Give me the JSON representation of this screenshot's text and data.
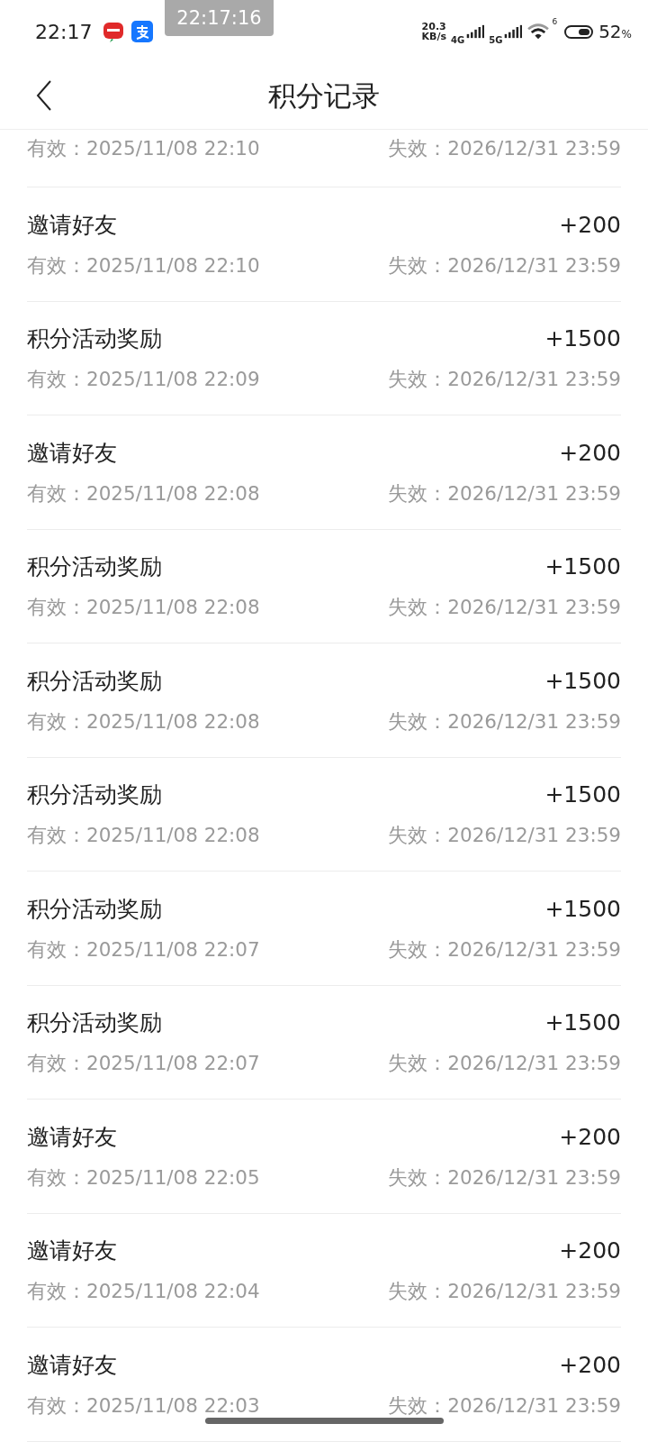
{
  "status_bar": {
    "time": "22:17",
    "floating_clock": "22:17:16",
    "net_speed": "20.3",
    "net_unit": "KB/s",
    "sim1": "4G",
    "sim2": "5G",
    "wifi_label": "6",
    "battery": "52",
    "battery_unit": "%"
  },
  "header": {
    "title": "积分记录"
  },
  "partial_record": {
    "valid_label": "有效：",
    "valid": "2025/11/08 22:10",
    "expire_label": "失效：",
    "expire": "2026/12/31 23:59"
  },
  "records": [
    {
      "title": "邀请好友",
      "points": "+200",
      "valid_label": "有效：",
      "valid": "2025/11/08 22:10",
      "expire_label": "失效：",
      "expire": "2026/12/31 23:59"
    },
    {
      "title": "积分活动奖励",
      "points": "+1500",
      "valid_label": "有效：",
      "valid": "2025/11/08 22:09",
      "expire_label": "失效：",
      "expire": "2026/12/31 23:59"
    },
    {
      "title": "邀请好友",
      "points": "+200",
      "valid_label": "有效：",
      "valid": "2025/11/08 22:08",
      "expire_label": "失效：",
      "expire": "2026/12/31 23:59"
    },
    {
      "title": "积分活动奖励",
      "points": "+1500",
      "valid_label": "有效：",
      "valid": "2025/11/08 22:08",
      "expire_label": "失效：",
      "expire": "2026/12/31 23:59"
    },
    {
      "title": "积分活动奖励",
      "points": "+1500",
      "valid_label": "有效：",
      "valid": "2025/11/08 22:08",
      "expire_label": "失效：",
      "expire": "2026/12/31 23:59"
    },
    {
      "title": "积分活动奖励",
      "points": "+1500",
      "valid_label": "有效：",
      "valid": "2025/11/08 22:08",
      "expire_label": "失效：",
      "expire": "2026/12/31 23:59"
    },
    {
      "title": "积分活动奖励",
      "points": "+1500",
      "valid_label": "有效：",
      "valid": "2025/11/08 22:07",
      "expire_label": "失效：",
      "expire": "2026/12/31 23:59"
    },
    {
      "title": "积分活动奖励",
      "points": "+1500",
      "valid_label": "有效：",
      "valid": "2025/11/08 22:07",
      "expire_label": "失效：",
      "expire": "2026/12/31 23:59"
    },
    {
      "title": "邀请好友",
      "points": "+200",
      "valid_label": "有效：",
      "valid": "2025/11/08 22:05",
      "expire_label": "失效：",
      "expire": "2026/12/31 23:59"
    },
    {
      "title": "邀请好友",
      "points": "+200",
      "valid_label": "有效：",
      "valid": "2025/11/08 22:04",
      "expire_label": "失效：",
      "expire": "2026/12/31 23:59"
    },
    {
      "title": "邀请好友",
      "points": "+200",
      "valid_label": "有效：",
      "valid": "2025/11/08 22:03",
      "expire_label": "失效：",
      "expire": "2026/12/31 23:59"
    }
  ]
}
